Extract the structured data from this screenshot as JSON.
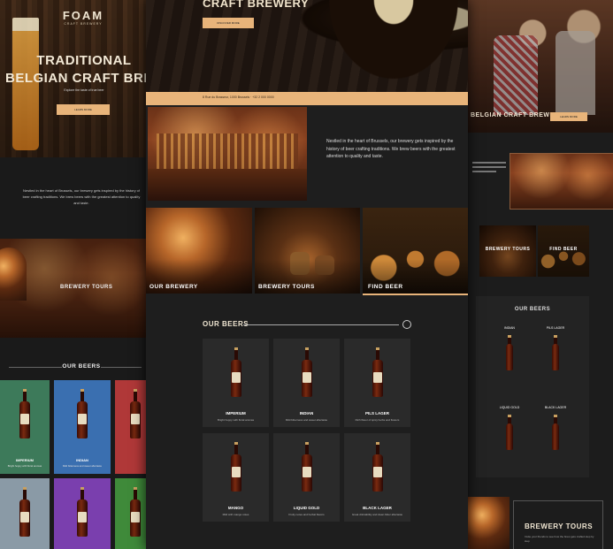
{
  "left_page": {
    "logo": "FOAM",
    "logo_sub": "CRAFT BREWERY",
    "hero_line1": "TRADITIONAL",
    "hero_line2": "BELGIAN CRAFT BREWERY",
    "hero_sub": "Explore the taste of true beer",
    "hero_button": "LEARN MORE",
    "intro_text": "Nestled in the heart of Brussels, our brewery gets inspired by the history of beer crafting traditions. We brew beers with the greatest attention to quality and taste.",
    "tours_label": "BREWERY TOURS",
    "beers_heading": "OUR BEERS",
    "beers": [
      {
        "name": "IMPERIUM",
        "desc": "Bright hoppy with floral aromas"
      },
      {
        "name": "INDIAN",
        "desc": "Mild bitterness and sweet aftertaste"
      },
      {
        "name": "",
        "desc": ""
      }
    ]
  },
  "center_page": {
    "hero_title": "CRAFT BREWERY",
    "hero_button": "DISCOVER MORE",
    "info_bar": "8 Rue du Brasseur, 1000 Brussels  ·  +32 2 000 0000",
    "intro_text": "Nestled in the heart of Brussels, our brewery gets inspired by the history of beer crafting traditions. We brew beers with the greatest attention to quality and taste.",
    "tiles": [
      "OUR BREWERY",
      "BREWERY TOURS",
      "FIND BEER"
    ],
    "beers_heading": "OUR BEERS",
    "beers": [
      {
        "name": "IMPERIUM",
        "desc": "Bright hoppy with floral aromas"
      },
      {
        "name": "INDIAN",
        "desc": "Mild bitterness and sweet aftertaste"
      },
      {
        "name": "PILS LAGER",
        "desc": "Rich flavor of spicy herbs and flowers"
      },
      {
        "name": "MANGO",
        "desc": "Mild with mango notes"
      },
      {
        "name": "LIQUID GOLD",
        "desc": "Fruity notes and herbal flavors"
      },
      {
        "name": "BLACK LAGER",
        "desc": "Great drinkability and clean bitter aftertaste"
      }
    ]
  },
  "right_page": {
    "hero_title": "BELGIAN CRAFT BREWERY",
    "hero_button": "LEARN MORE",
    "tiles": [
      "BREWERY TOURS",
      "FIND BEER"
    ],
    "beers_heading": "OUR BEERS",
    "beers": [
      {
        "name": "INDIAN"
      },
      {
        "name": "PILS LAGER"
      },
      {
        "name": "LIQUID GOLD"
      },
      {
        "name": "BLACK LAGER"
      }
    ],
    "tours_heading": "BREWERY TOURS",
    "tours_text": "Invite your friends to see how the brew gets crafted step by step"
  },
  "colors": {
    "accent": "#e8b47a",
    "background": "#141414",
    "card": "#2a2a2a"
  }
}
